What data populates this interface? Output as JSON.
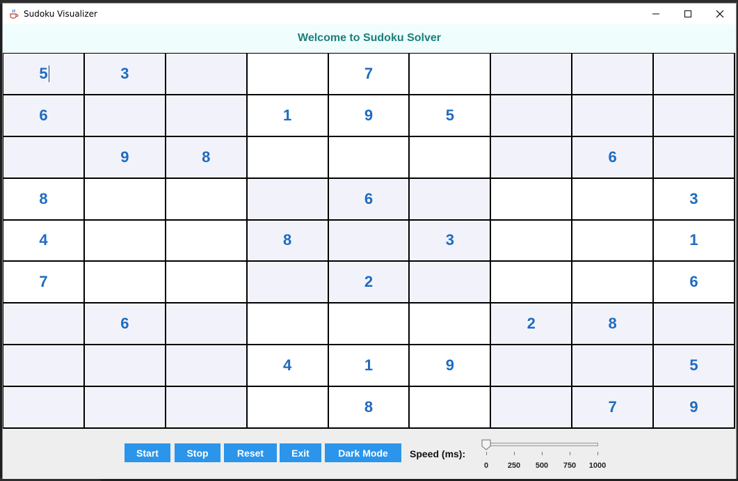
{
  "window": {
    "title": "Sudoku Visualizer"
  },
  "banner": {
    "text": "Welcome to Sudoku Solver"
  },
  "board": {
    "rows": [
      [
        "5",
        "3",
        "",
        "",
        "7",
        "",
        "",
        "",
        ""
      ],
      [
        "6",
        "",
        "",
        "1",
        "9",
        "5",
        "",
        "",
        ""
      ],
      [
        "",
        "9",
        "8",
        "",
        "",
        "",
        "",
        "6",
        ""
      ],
      [
        "8",
        "",
        "",
        "",
        "6",
        "",
        "",
        "",
        "3"
      ],
      [
        "4",
        "",
        "",
        "8",
        "",
        "3",
        "",
        "",
        "1"
      ],
      [
        "7",
        "",
        "",
        "",
        "2",
        "",
        "",
        "",
        "6"
      ],
      [
        "",
        "6",
        "",
        "",
        "",
        "",
        "2",
        "8",
        ""
      ],
      [
        "",
        "",
        "",
        "4",
        "1",
        "9",
        "",
        "",
        "5"
      ],
      [
        "",
        "",
        "",
        "",
        "8",
        "",
        "",
        "7",
        "9"
      ]
    ]
  },
  "controls": {
    "start_label": "Start",
    "stop_label": "Stop",
    "reset_label": "Reset",
    "exit_label": "Exit",
    "dark_mode_label": "Dark Mode",
    "speed_label": "Speed (ms):",
    "speed_value": 0,
    "speed_ticks": [
      "0",
      "250",
      "500",
      "750",
      "1000"
    ]
  },
  "colors": {
    "digit": "#1e6bc0",
    "banner_text": "#1a7f7a",
    "button_bg": "#2a95ea",
    "shaded_cell": "#f2f3fa"
  }
}
